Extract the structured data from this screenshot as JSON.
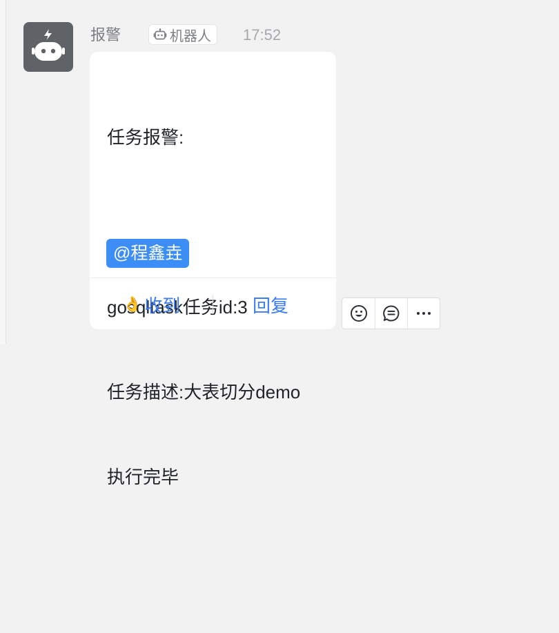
{
  "message": {
    "sender_name": "报警",
    "bot_badge_label": "机器人",
    "timestamp": "17:52",
    "lines": [
      "任务报警:",
      "",
      "gosqltask任务id:3",
      "任务描述:大表切分demo",
      "执行完毕",
      ""
    ],
    "mention": "@程鑫垚"
  },
  "actions": {
    "ack_label": "收到",
    "ack_emoji": "👌",
    "reply_label": "回复"
  },
  "toolbar": {
    "icons": [
      "emoji-icon",
      "comment-icon",
      "more-icon"
    ]
  },
  "colors": {
    "background": "#f2f2f3",
    "bubble": "#ffffff",
    "accent_blue": "#3c7cf2",
    "mention_bg": "#3c8df5",
    "avatar_bg": "#5f6367"
  }
}
